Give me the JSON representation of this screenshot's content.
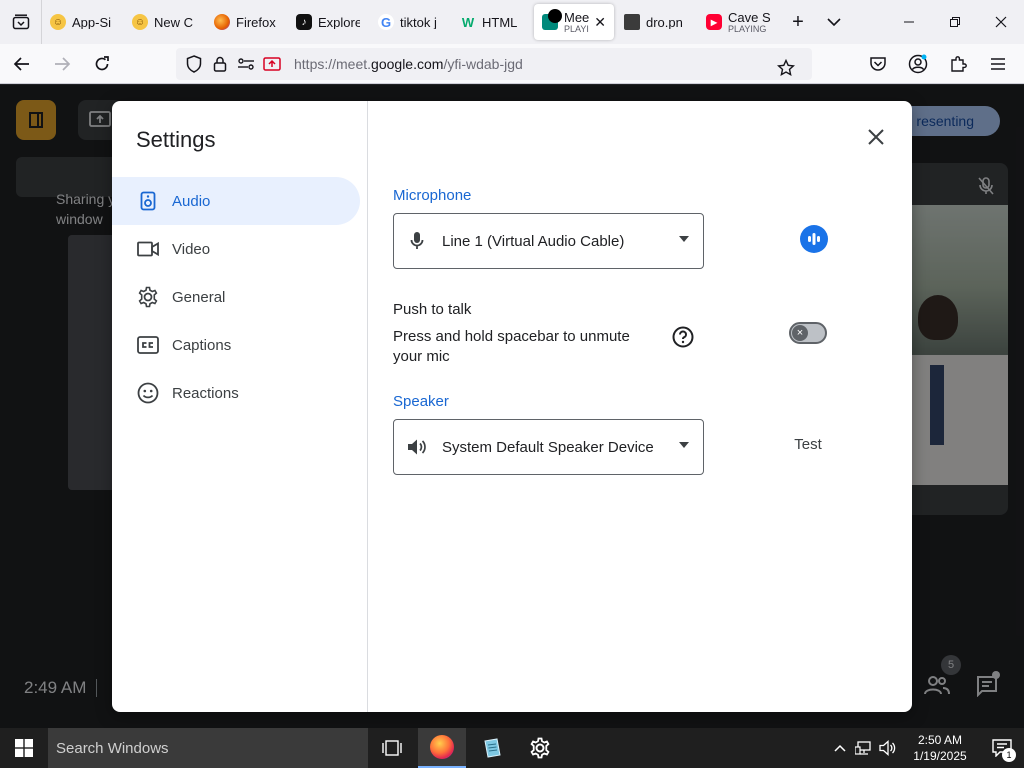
{
  "browser": {
    "tabs": [
      {
        "label": "App-Si",
        "sub": "",
        "icon": "emoji-icon",
        "color": "#f6c544"
      },
      {
        "label": "New C",
        "sub": "",
        "icon": "emoji-icon",
        "color": "#f6c544"
      },
      {
        "label": "Firefox",
        "sub": "",
        "icon": "firefox-icon",
        "color": "#e66000"
      },
      {
        "label": "Explore",
        "sub": "",
        "icon": "tiktok-icon",
        "color": "#111111"
      },
      {
        "label": "tiktok j",
        "sub": "",
        "icon": "google-icon",
        "color": "#4285f4"
      },
      {
        "label": "HTML",
        "sub": "",
        "icon": "w3schools-icon",
        "color": "#04aa6d"
      },
      {
        "label": "Mee",
        "sub": "PLAYI",
        "icon": "meet-icon",
        "color": "#00897b"
      },
      {
        "label": "dro.pn",
        "sub": "",
        "icon": "dropbox-icon",
        "color": "#3b3b3b"
      },
      {
        "label": "Cave S",
        "sub": "PLAYING",
        "icon": "youtube-icon",
        "color": "#ff0033"
      }
    ],
    "url_prefix": "https://meet.",
    "url_domain": "google.com",
    "url_path": "/yfi-wdab-jgd"
  },
  "meet": {
    "presenting_label": "resenting",
    "share_line1": "Sharing y",
    "share_line2": "window",
    "time": "2:49 AM",
    "people_count": "5"
  },
  "settings": {
    "title": "Settings",
    "nav": [
      {
        "label": "Audio",
        "icon": "speaker-icon"
      },
      {
        "label": "Video",
        "icon": "videocam-icon"
      },
      {
        "label": "General",
        "icon": "gear-icon"
      },
      {
        "label": "Captions",
        "icon": "cc-icon"
      },
      {
        "label": "Reactions",
        "icon": "smiley-icon"
      }
    ],
    "microphone": {
      "label": "Microphone",
      "value": "Line 1 (Virtual Audio Cable)"
    },
    "push_to_talk": {
      "label": "Push to talk",
      "description": "Press and hold spacebar to unmute your mic",
      "enabled": false
    },
    "speaker": {
      "label": "Speaker",
      "value": "System Default Speaker Device",
      "test_label": "Test"
    }
  },
  "taskbar": {
    "search_placeholder": "Search Windows",
    "clock_time": "2:50 AM",
    "clock_date": "1/19/2025",
    "notification_count": "1"
  },
  "colors": {
    "accent": "#1a73e8",
    "active_nav_bg": "#e8f0fe",
    "meet_bg": "#202124"
  }
}
